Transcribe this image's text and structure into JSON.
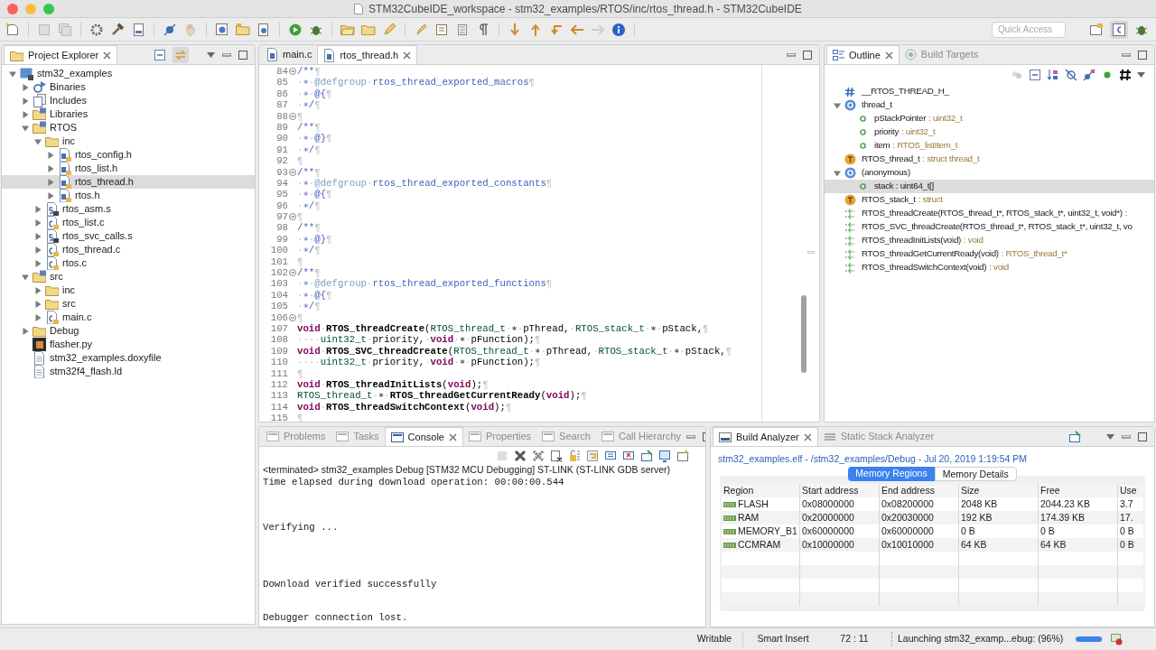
{
  "window": {
    "title": "STM32CubeIDE_workspace - stm32_examples/RTOS/inc/rtos_thread.h - STM32CubeIDE"
  },
  "toolbar": {
    "quick_access": {
      "placeholder": "Quick Access"
    }
  },
  "project_explorer": {
    "tabs": [
      {
        "label": "Project Explorer",
        "selected": true
      }
    ],
    "items": [
      {
        "label": "stm32_examples",
        "kind": "project",
        "expanded": true,
        "selected": false,
        "children": [
          {
            "label": "Binaries",
            "kind": "binaries",
            "expanded": false,
            "selected": false
          },
          {
            "label": "Includes",
            "kind": "includes",
            "expanded": false,
            "selected": false
          },
          {
            "label": "Libraries",
            "kind": "source-folder",
            "expanded": false,
            "selected": false
          },
          {
            "label": "RTOS",
            "kind": "source-folder",
            "expanded": true,
            "selected": false,
            "children": [
              {
                "label": "inc",
                "kind": "folder",
                "expanded": true,
                "selected": false,
                "children": [
                  {
                    "label": "rtos_config.h",
                    "kind": "header",
                    "expanded": false,
                    "selected": false
                  },
                  {
                    "label": "rtos_list.h",
                    "kind": "header",
                    "expanded": false,
                    "selected": false
                  },
                  {
                    "label": "rtos_thread.h",
                    "kind": "header",
                    "expanded": false,
                    "selected": true
                  },
                  {
                    "label": "rtos.h",
                    "kind": "header",
                    "expanded": false,
                    "selected": false
                  }
                ]
              },
              {
                "label": "rtos_asm.s",
                "kind": "asm",
                "expanded": false,
                "selected": false
              },
              {
                "label": "rtos_list.c",
                "kind": "source",
                "expanded": false,
                "selected": false
              },
              {
                "label": "rtos_svc_calls.s",
                "kind": "asm",
                "expanded": false,
                "selected": false
              },
              {
                "label": "rtos_thread.c",
                "kind": "source",
                "expanded": false,
                "selected": false
              },
              {
                "label": "rtos.c",
                "kind": "source",
                "expanded": false,
                "selected": false
              }
            ]
          },
          {
            "label": "src",
            "kind": "source-folder",
            "expanded": true,
            "selected": false,
            "children": [
              {
                "label": "inc",
                "kind": "folder",
                "expanded": false,
                "selected": false
              },
              {
                "label": "src",
                "kind": "folder",
                "expanded": false,
                "selected": false
              },
              {
                "label": "main.c",
                "kind": "source",
                "expanded": false,
                "selected": false
              }
            ]
          },
          {
            "label": "Debug",
            "kind": "folder",
            "expanded": false,
            "selected": false
          },
          {
            "label": "flasher.py",
            "kind": "script",
            "selected": false
          },
          {
            "label": "stm32_examples.doxyfile",
            "kind": "document",
            "selected": false
          },
          {
            "label": "stm32f4_flash.ld",
            "kind": "document",
            "selected": false
          }
        ]
      }
    ]
  },
  "editor": {
    "tabs": [
      {
        "label": "main.c",
        "selected": false
      },
      {
        "label": "rtos_thread.h",
        "selected": true
      }
    ],
    "lines": [
      {
        "number": "84",
        "fold": true,
        "tokens": [
          {
            "text": "/**",
            "kind": "comment"
          },
          {
            "text": "¶",
            "kind": "plain"
          }
        ]
      },
      {
        "number": "85",
        "fold": false,
        "tokens": [
          {
            "text": "·∗·",
            "kind": "comment"
          },
          {
            "text": "@defgroup",
            "kind": "doctag"
          },
          {
            "text": "·rtos_thread_exported_macros¶",
            "kind": "comment"
          }
        ]
      },
      {
        "number": "86",
        "fold": false,
        "tokens": [
          {
            "text": "·∗·@{¶",
            "kind": "comment"
          }
        ]
      },
      {
        "number": "87",
        "fold": false,
        "tokens": [
          {
            "text": "·∗/¶",
            "kind": "comment"
          }
        ]
      },
      {
        "number": "88",
        "fold": true,
        "tokens": [
          {
            "text": "¶",
            "kind": "plain"
          }
        ]
      },
      {
        "number": "89",
        "fold": false,
        "tokens": [
          {
            "text": "/**¶",
            "kind": "comment"
          }
        ]
      },
      {
        "number": "90",
        "fold": false,
        "tokens": [
          {
            "text": "·∗·@}¶",
            "kind": "comment"
          }
        ]
      },
      {
        "number": "91",
        "fold": false,
        "tokens": [
          {
            "text": "·∗/¶",
            "kind": "comment"
          }
        ]
      },
      {
        "number": "92",
        "fold": false,
        "tokens": [
          {
            "text": "¶",
            "kind": "plain"
          }
        ]
      },
      {
        "number": "93",
        "fold": true,
        "tokens": [
          {
            "text": "/**¶",
            "kind": "comment"
          }
        ]
      },
      {
        "number": "94",
        "fold": false,
        "tokens": [
          {
            "text": "·∗·",
            "kind": "comment"
          },
          {
            "text": "@defgroup",
            "kind": "doctag"
          },
          {
            "text": "·rtos_thread_exported_constants¶",
            "kind": "comment"
          }
        ]
      },
      {
        "number": "95",
        "fold": false,
        "tokens": [
          {
            "text": "·∗·@{¶",
            "kind": "comment"
          }
        ]
      },
      {
        "number": "96",
        "fold": false,
        "tokens": [
          {
            "text": "·∗/¶",
            "kind": "comment"
          }
        ]
      },
      {
        "number": "97",
        "fold": true,
        "tokens": [
          {
            "text": "¶",
            "kind": "plain"
          }
        ]
      },
      {
        "number": "98",
        "fold": false,
        "tokens": [
          {
            "text": "/**¶",
            "kind": "comment"
          }
        ]
      },
      {
        "number": "99",
        "fold": false,
        "tokens": [
          {
            "text": "·∗·@}¶",
            "kind": "comment"
          }
        ]
      },
      {
        "number": "100",
        "fold": false,
        "tokens": [
          {
            "text": "·∗/¶",
            "kind": "comment"
          }
        ]
      },
      {
        "number": "101",
        "fold": false,
        "tokens": [
          {
            "text": "¶",
            "kind": "plain"
          }
        ]
      },
      {
        "number": "102",
        "fold": true,
        "tokens": [
          {
            "text": "/**¶",
            "kind": "comment"
          }
        ]
      },
      {
        "number": "103",
        "fold": false,
        "tokens": [
          {
            "text": "·∗·",
            "kind": "comment"
          },
          {
            "text": "@defgroup",
            "kind": "doctag"
          },
          {
            "text": "·rtos_thread_exported_functions¶",
            "kind": "comment"
          }
        ]
      },
      {
        "number": "104",
        "fold": false,
        "tokens": [
          {
            "text": "·∗·@{¶",
            "kind": "comment"
          }
        ]
      },
      {
        "number": "105",
        "fold": false,
        "tokens": [
          {
            "text": "·∗/¶",
            "kind": "comment"
          }
        ]
      },
      {
        "number": "106",
        "fold": true,
        "tokens": [
          {
            "text": "¶",
            "kind": "plain"
          }
        ]
      },
      {
        "number": "107",
        "fold": false,
        "tokens": [
          {
            "text": "void",
            "kind": "keyword"
          },
          {
            "text": "·",
            "kind": "plain"
          },
          {
            "text": "RTOS_threadCreate",
            "kind": "function"
          },
          {
            "text": "(",
            "kind": "plain"
          },
          {
            "text": "RTOS_thread_t",
            "kind": "type"
          },
          {
            "text": "·∗·pThread,·",
            "kind": "plain"
          },
          {
            "text": "RTOS_stack_t",
            "kind": "type"
          },
          {
            "text": "·∗·pStack,¶",
            "kind": "plain"
          }
        ]
      },
      {
        "number": "108",
        "fold": false,
        "tokens": [
          {
            "text": "····",
            "kind": "plain"
          },
          {
            "text": "uint32_t",
            "kind": "type"
          },
          {
            "text": "·priority,·",
            "kind": "plain"
          },
          {
            "text": "void",
            "kind": "keyword"
          },
          {
            "text": "·∗·pFunction);¶",
            "kind": "plain"
          }
        ]
      },
      {
        "number": "109",
        "fold": false,
        "tokens": [
          {
            "text": "void",
            "kind": "keyword"
          },
          {
            "text": "·",
            "kind": "plain"
          },
          {
            "text": "RTOS_SVC_threadCreate",
            "kind": "function"
          },
          {
            "text": "(",
            "kind": "plain"
          },
          {
            "text": "RTOS_thread_t",
            "kind": "type"
          },
          {
            "text": "·∗·pThread,·",
            "kind": "plain"
          },
          {
            "text": "RTOS_stack_t",
            "kind": "type"
          },
          {
            "text": "·∗·pStack,¶",
            "kind": "plain"
          }
        ]
      },
      {
        "number": "110",
        "fold": false,
        "tokens": [
          {
            "text": "····",
            "kind": "plain"
          },
          {
            "text": "uint32_t",
            "kind": "type"
          },
          {
            "text": "·priority,·",
            "kind": "plain"
          },
          {
            "text": "void",
            "kind": "keyword"
          },
          {
            "text": "·∗·pFunction);¶",
            "kind": "plain"
          }
        ]
      },
      {
        "number": "111",
        "fold": false,
        "tokens": [
          {
            "text": "¶",
            "kind": "plain"
          }
        ]
      },
      {
        "number": "112",
        "fold": false,
        "tokens": [
          {
            "text": "void",
            "kind": "keyword"
          },
          {
            "text": "·",
            "kind": "plain"
          },
          {
            "text": "RTOS_threadInitLists",
            "kind": "function"
          },
          {
            "text": "(",
            "kind": "plain"
          },
          {
            "text": "void",
            "kind": "keyword"
          },
          {
            "text": ");¶",
            "kind": "plain"
          }
        ]
      },
      {
        "number": "113",
        "fold": false,
        "tokens": [
          {
            "text": "RTOS_thread_t",
            "kind": "type"
          },
          {
            "text": "·∗·",
            "kind": "plain"
          },
          {
            "text": "RTOS_threadGetCurrentReady",
            "kind": "function"
          },
          {
            "text": "(",
            "kind": "plain"
          },
          {
            "text": "void",
            "kind": "keyword"
          },
          {
            "text": ");¶",
            "kind": "plain"
          }
        ]
      },
      {
        "number": "114",
        "fold": false,
        "tokens": [
          {
            "text": "void",
            "kind": "keyword"
          },
          {
            "text": "·",
            "kind": "plain"
          },
          {
            "text": "RTOS_threadSwitchContext",
            "kind": "function"
          },
          {
            "text": "(",
            "kind": "plain"
          },
          {
            "text": "void",
            "kind": "keyword"
          },
          {
            "text": ");¶",
            "kind": "plain"
          }
        ]
      },
      {
        "number": "115",
        "fold": false,
        "tokens": [
          {
            "text": "¶",
            "kind": "plain"
          }
        ]
      }
    ]
  },
  "outline": {
    "tabs": [
      {
        "label": "Outline",
        "selected": true
      },
      {
        "label": "Build Targets",
        "selected": false
      }
    ],
    "items": [
      {
        "kind": "macro",
        "name": "__RTOS_THREAD_H_",
        "selected": false
      },
      {
        "kind": "struct",
        "name": "thread_t",
        "expanded": true,
        "selected": false,
        "children": [
          {
            "kind": "field",
            "name": "pStackPointer",
            "detail": ": uint32_t",
            "selected": false
          },
          {
            "kind": "field",
            "name": "priority",
            "detail": ": uint32_t",
            "selected": false
          },
          {
            "kind": "field",
            "name": "item",
            "detail": ": RTOS_listItem_t",
            "selected": false
          }
        ]
      },
      {
        "kind": "typedef",
        "name": "RTOS_thread_t",
        "detail": ": struct thread_t",
        "selected": false
      },
      {
        "kind": "struct",
        "name": "(anonymous)",
        "expanded": true,
        "selected": false,
        "children": [
          {
            "kind": "field",
            "name": "stack : uint64_t[]",
            "selected": true
          }
        ]
      },
      {
        "kind": "typedef",
        "name": "RTOS_stack_t",
        "detail": ": struct",
        "selected": false
      },
      {
        "kind": "function",
        "name": "RTOS_threadCreate(RTOS_thread_t*, RTOS_stack_t*, uint32_t, void*)",
        "detail": ":",
        "selected": false
      },
      {
        "kind": "function",
        "name": "RTOS_SVC_threadCreate(RTOS_thread_t*, RTOS_stack_t*, uint32_t, vo",
        "selected": false
      },
      {
        "kind": "function",
        "name": "RTOS_threadInitLists(void)",
        "detail": ": void",
        "selected": false
      },
      {
        "kind": "function",
        "name": "RTOS_threadGetCurrentReady(void)",
        "detail": ": RTOS_thread_t*",
        "selected": false
      },
      {
        "kind": "function",
        "name": "RTOS_threadSwitchContext(void)",
        "detail": ": void",
        "selected": false
      }
    ]
  },
  "console": {
    "tabs": [
      {
        "label": "Problems",
        "selected": false
      },
      {
        "label": "Tasks",
        "selected": false
      },
      {
        "label": "Console",
        "selected": true
      },
      {
        "label": "Properties",
        "selected": false
      },
      {
        "label": "Search",
        "selected": false
      },
      {
        "label": "Call Hierarchy",
        "selected": false
      }
    ],
    "process": "<terminated> stm32_examples Debug [STM32 MCU Debugging] ST-LINK (ST-LINK GDB server)",
    "output": "Time elapsed during download operation: 00:00:00.544\n\n\n\nVerifying ...\n\n\n\n\nDownload verified successfully\n\n\nDebugger connection lost."
  },
  "build_analyzer": {
    "tabs": [
      {
        "label": "Build Analyzer",
        "selected": true
      },
      {
        "label": "Static Stack Analyzer",
        "selected": false
      }
    ],
    "file_info": "stm32_examples.elf - /stm32_examples/Debug - Jul 20, 2019 1:19:54 PM",
    "view_tabs": [
      {
        "label": "Memory Regions",
        "selected": true
      },
      {
        "label": "Memory Details",
        "selected": false
      }
    ],
    "table": {
      "columns": [
        "Region",
        "Start address",
        "End address",
        "Size",
        "Free",
        "Use"
      ],
      "rows": [
        [
          "FLASH",
          "0x08000000",
          "0x08200000",
          "2048 KB",
          "2044.23 KB",
          "3.7"
        ],
        [
          "RAM",
          "0x20000000",
          "0x20030000",
          "192 KB",
          "174.39 KB",
          "17."
        ],
        [
          "MEMORY_B1",
          "0x60000000",
          "0x60000000",
          "0 B",
          "0 B",
          "0 B"
        ],
        [
          "CCMRAM",
          "0x10000000",
          "0x10010000",
          "64 KB",
          "64 KB",
          "0 B"
        ]
      ]
    }
  },
  "status_bar": {
    "mode": "Writable",
    "insert_mode": "Smart Insert",
    "position": "72 : 11",
    "progress": {
      "label": "Launching stm32_examp...ebug: (96%)",
      "level": 0.96
    }
  }
}
